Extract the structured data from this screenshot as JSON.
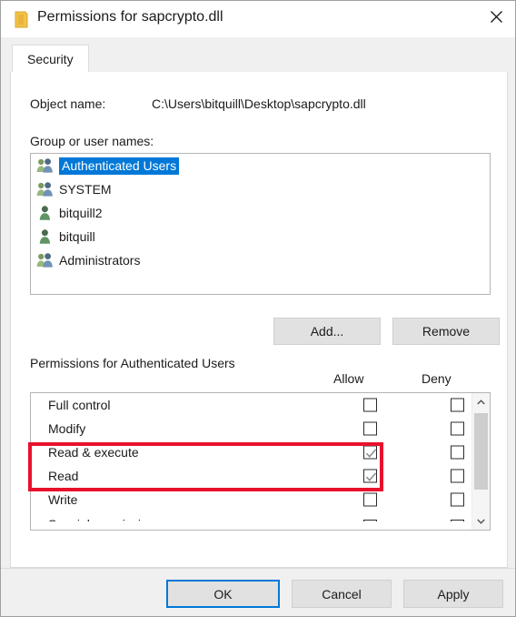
{
  "window": {
    "title": "Permissions for sapcrypto.dll",
    "icon": "file-properties-icon",
    "close_label": "✕"
  },
  "tabs": [
    {
      "label": "Security",
      "active": true
    }
  ],
  "object": {
    "label": "Object name:",
    "value": "C:\\Users\\bitquill\\Desktop\\sapcrypto.dll"
  },
  "group_section": {
    "label": "Group or user names:",
    "items": [
      {
        "name": "Authenticated Users",
        "icon": "group-users-icon",
        "selected": true
      },
      {
        "name": "SYSTEM",
        "icon": "group-users-icon",
        "selected": false
      },
      {
        "name": "bitquill2",
        "icon": "single-user-icon",
        "selected": false
      },
      {
        "name": "bitquill",
        "icon": "single-user-icon",
        "selected": false
      },
      {
        "name": "Administrators",
        "icon": "group-users-icon",
        "selected": false
      }
    ],
    "buttons": {
      "add": "Add...",
      "remove": "Remove"
    }
  },
  "permissions_section": {
    "title": "Permissions for Authenticated Users",
    "columns": {
      "allow": "Allow",
      "deny": "Deny"
    },
    "rows": [
      {
        "name": "Full control",
        "allow": false,
        "deny": false,
        "highlighted": false,
        "partial": false
      },
      {
        "name": "Modify",
        "allow": false,
        "deny": false,
        "highlighted": false,
        "partial": false
      },
      {
        "name": "Read & execute",
        "allow": true,
        "deny": false,
        "highlighted": true,
        "partial": false
      },
      {
        "name": "Read",
        "allow": true,
        "deny": false,
        "highlighted": true,
        "partial": false
      },
      {
        "name": "Write",
        "allow": false,
        "deny": false,
        "highlighted": false,
        "partial": false
      },
      {
        "name": "Special permissions",
        "allow": false,
        "deny": false,
        "highlighted": false,
        "partial": true
      }
    ],
    "scrollbar": {
      "up_arrow": "scroll-up-chevron",
      "down_arrow": "scroll-down-chevron"
    }
  },
  "annotation": {
    "color": "#e8112d",
    "target": "Read & execute / Read Allow checkboxes"
  },
  "footer": {
    "ok": "OK",
    "cancel": "Cancel",
    "apply": "Apply"
  },
  "colors": {
    "selection_blue": "#0078d7",
    "focus_blue": "#0078d7",
    "annotation_red": "#e8112d",
    "dialog_bg": "#f0f0f0",
    "panel_bg": "#ffffff"
  }
}
